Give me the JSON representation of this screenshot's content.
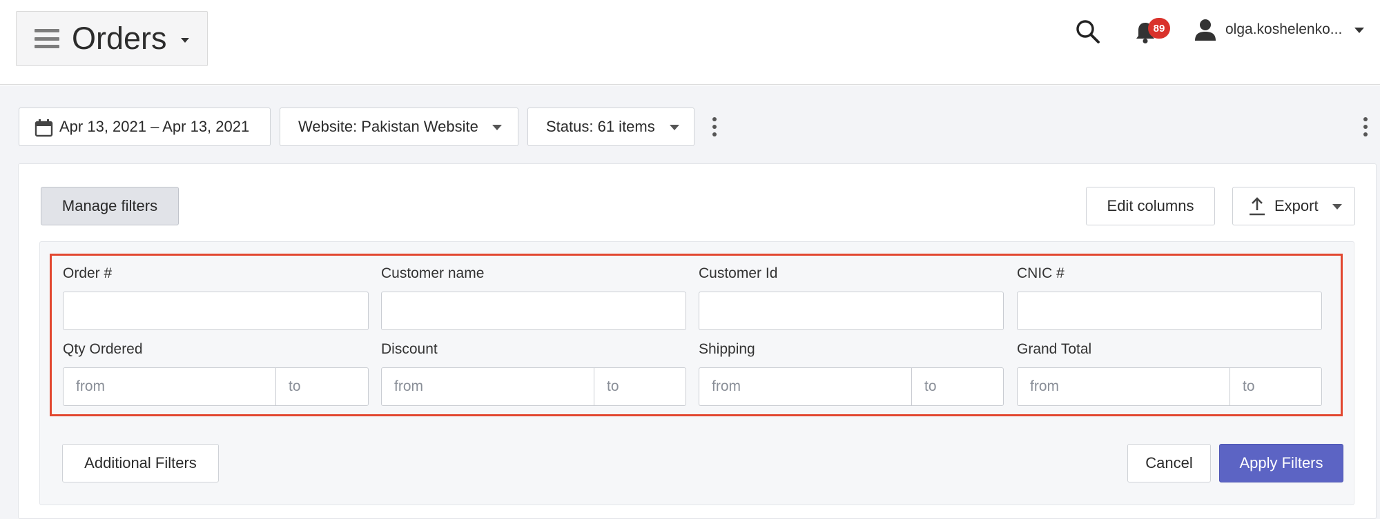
{
  "header": {
    "title": "Orders",
    "notifications_count": "89",
    "user_name": "olga.koshelenko..."
  },
  "toolbar": {
    "date_range": "Apr 13, 2021 – Apr 13, 2021",
    "website_filter": "Website: Pakistan Website",
    "status_filter": "Status: 61 items"
  },
  "card": {
    "manage_filters": "Manage filters",
    "edit_columns": "Edit columns",
    "export": "Export"
  },
  "filters": {
    "text_fields": [
      {
        "label": "Order #",
        "value": ""
      },
      {
        "label": "Customer name",
        "value": ""
      },
      {
        "label": "Customer Id",
        "value": ""
      },
      {
        "label": "CNIC #",
        "value": ""
      }
    ],
    "range_fields": [
      {
        "label": "Qty Ordered",
        "from_placeholder": "from",
        "to_placeholder": "to"
      },
      {
        "label": "Discount",
        "from_placeholder": "from",
        "to_placeholder": "to"
      },
      {
        "label": "Shipping",
        "from_placeholder": "from",
        "to_placeholder": "to"
      },
      {
        "label": "Grand Total",
        "from_placeholder": "from",
        "to_placeholder": "to"
      }
    ],
    "highlight_color": "#e24730"
  },
  "actions": {
    "additional_filters": "Additional Filters",
    "cancel": "Cancel",
    "apply_filters": "Apply Filters",
    "apply_color": "#5c64c4"
  }
}
